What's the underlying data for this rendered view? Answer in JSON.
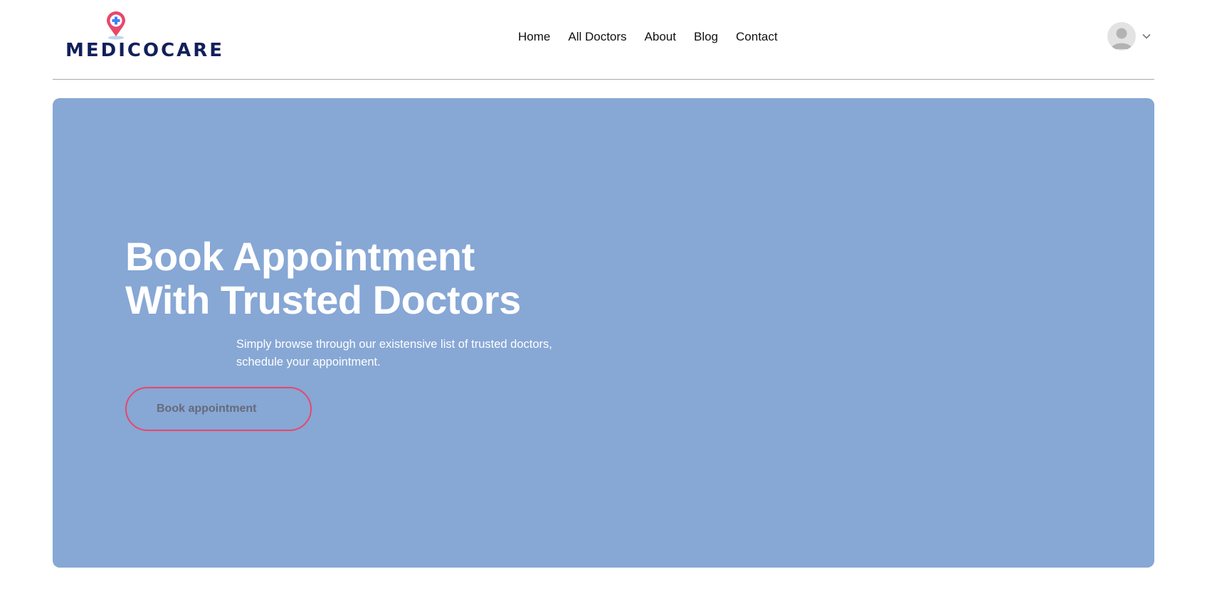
{
  "brand": {
    "name": "MEDICOCARE",
    "colors": {
      "text": "#12205a",
      "pin": "#e8476a",
      "cross": "#3b82f6"
    }
  },
  "nav": {
    "items": [
      {
        "label": "Home"
      },
      {
        "label": "All Doctors"
      },
      {
        "label": "About"
      },
      {
        "label": "Blog"
      },
      {
        "label": "Contact"
      }
    ]
  },
  "account": {
    "avatar_icon": "user-avatar-icon",
    "dropdown_icon": "chevron-down-icon"
  },
  "hero": {
    "title_line1": "Book Appointment",
    "title_line2": "With Trusted Doctors",
    "desc_line1": "Simply browse through our existensive list of trusted doctors,",
    "desc_line2": "schedule your appointment.",
    "button_label": "Book appointment",
    "colors": {
      "background": "#87a7d5",
      "button_border": "#e8476a"
    }
  }
}
